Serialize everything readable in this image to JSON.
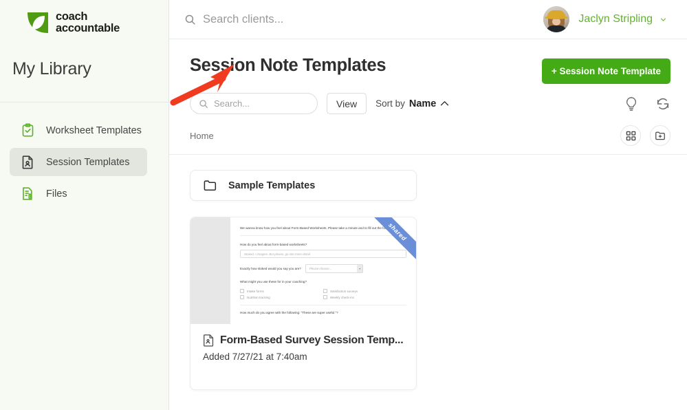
{
  "sidebar": {
    "logo": {
      "line1": "coach",
      "line2": "accountable",
      "icon": "leaf-logo-icon"
    },
    "library_title": "My Library",
    "items": [
      {
        "label": "Worksheet Templates",
        "icon": "clipboard-check-icon",
        "active": false
      },
      {
        "label": "Session Templates",
        "icon": "document-person-icon",
        "active": true
      },
      {
        "label": "Files",
        "icon": "document-attachment-icon",
        "active": false
      }
    ]
  },
  "topbar": {
    "search_placeholder": "Search clients...",
    "search_icon": "search-icon",
    "user_name": "Jaclyn Stripling",
    "caret_icon": "chevron-down-icon",
    "avatar_icon": "user-avatar"
  },
  "page": {
    "title": "Session Note Templates",
    "primary_button": "+ Session Note Template"
  },
  "toolbar": {
    "search_placeholder": "Search...",
    "search_icon": "search-icon",
    "view_label": "View",
    "sort_label": "Sort by",
    "sort_value": "Name",
    "sort_direction_icon": "chevron-up-icon",
    "tip_icon": "lightbulb-icon",
    "refresh_icon": "refresh-icon"
  },
  "breadcrumb": {
    "home": "Home",
    "grid_view_icon": "grid-view-icon",
    "new_folder_icon": "new-folder-icon"
  },
  "folders": [
    {
      "name": "Sample Templates",
      "icon": "folder-icon"
    }
  ],
  "cards": [
    {
      "badge": "shared",
      "icon": "session-note-icon",
      "title": "Form-Based Survey Session Temp...",
      "subtitle": "Added 7/27/21 at 7:40am",
      "preview": {
        "intro": "We wanna know how you feel about Form-Based Worksheets. Please take a minute and to fill out the following.",
        "q1_label": "How do you feel about form-based worksheets?",
        "q1_placeholder": "Stoked, I imagine. But please, go into more detail.",
        "q2_label": "Exactly how stoked would you say you are?",
        "q2_placeholder": "Please choose...",
        "q3_label": "What might you use these for in your coaching?",
        "q3_options": [
          "Intake forms",
          "Nutrition tracking",
          "Satisfaction surveys",
          "Weekly check-ins"
        ],
        "q4_label": "How much do you agree with the following: \"These are super useful.\"?"
      }
    }
  ],
  "annotation": {
    "arrow_color": "#f03b20",
    "arrow_name": "red-pointer-arrow"
  },
  "colors": {
    "brand_green": "#5fb52a",
    "button_green": "#44ab16",
    "sidebar_bg": "#f6faf2",
    "ribbon_blue": "#6a8fd8"
  }
}
